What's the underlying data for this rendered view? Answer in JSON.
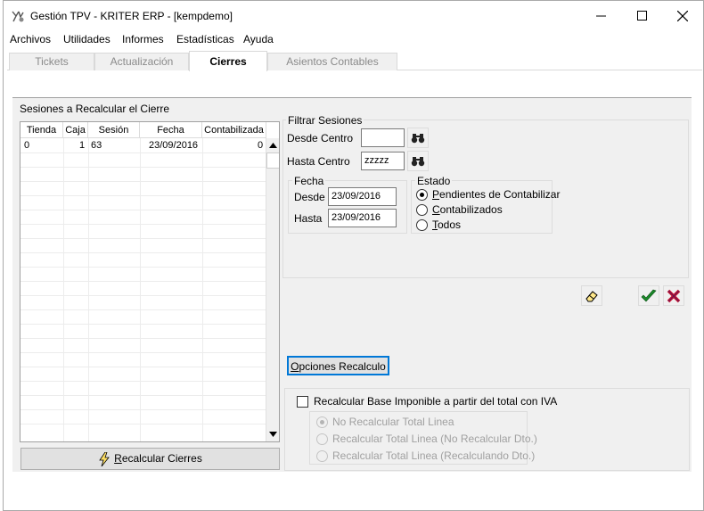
{
  "window": {
    "title": "Gestión TPV - KRITER ERP - [kempdemo]",
    "controls": {
      "minimize": "—",
      "maximize": "☐",
      "close": "✕"
    }
  },
  "menu": [
    "Archivos",
    "Utilidades",
    "Informes",
    "Estadísticas",
    "Ayuda"
  ],
  "tabs": [
    {
      "label": "Tickets",
      "active": false
    },
    {
      "label": "Actualización",
      "active": false
    },
    {
      "label": "Cierres",
      "active": true
    },
    {
      "label": "Asientos Contables",
      "active": false
    }
  ],
  "sessions_group": {
    "label": "Sesiones a Recalcular el Cierre",
    "columns": [
      "Tienda",
      "Caja",
      "Sesión",
      "Fecha",
      "Contabilizada"
    ],
    "rows": [
      [
        "0",
        "1",
        "63",
        "23/09/2016",
        "0"
      ]
    ],
    "recalc_button": {
      "label_first": "R",
      "label_rest": "ecalcular Cierres",
      "icon": "lightning-icon"
    }
  },
  "filter_group": {
    "label": "Filtrar Sesiones",
    "desde_centro": {
      "label": "Desde Centro",
      "value": ""
    },
    "hasta_centro": {
      "label": "Hasta Centro",
      "value": "zzzzz"
    },
    "search_icon": "binoculars-icon",
    "fecha": {
      "label": "Fecha",
      "desde": {
        "label": "Desde",
        "value": "23/09/2016"
      },
      "hasta": {
        "label": "Hasta",
        "value": "23/09/2016"
      }
    },
    "estado": {
      "label": "Estado",
      "options": [
        {
          "first": "P",
          "rest": "endientes de Contabilizar",
          "selected": true
        },
        {
          "first": "C",
          "rest": "ontabilizados",
          "selected": false
        },
        {
          "first": "T",
          "rest": "odos",
          "selected": false
        }
      ]
    }
  },
  "toolbar": {
    "eraser_icon": "eraser-icon",
    "accept_icon": "checkmark-icon",
    "cancel_icon": "red-x-icon",
    "accent_green": "#1a8a2a",
    "accent_red": "#c8102e"
  },
  "opciones_button": {
    "first": "O",
    "rest": "pciones Recalculo"
  },
  "recalc_options": {
    "checkbox_label": "Recalcular Base Imponible a partir del total con IVA",
    "checked": false,
    "options": [
      {
        "label": "No Recalcular Total Linea",
        "selected": true
      },
      {
        "label": "Recalcular Total Linea (No Recalcular Dto.)",
        "selected": false
      },
      {
        "label": "Recalcular Total Linea (Recalculando Dto.)",
        "selected": false
      }
    ]
  }
}
